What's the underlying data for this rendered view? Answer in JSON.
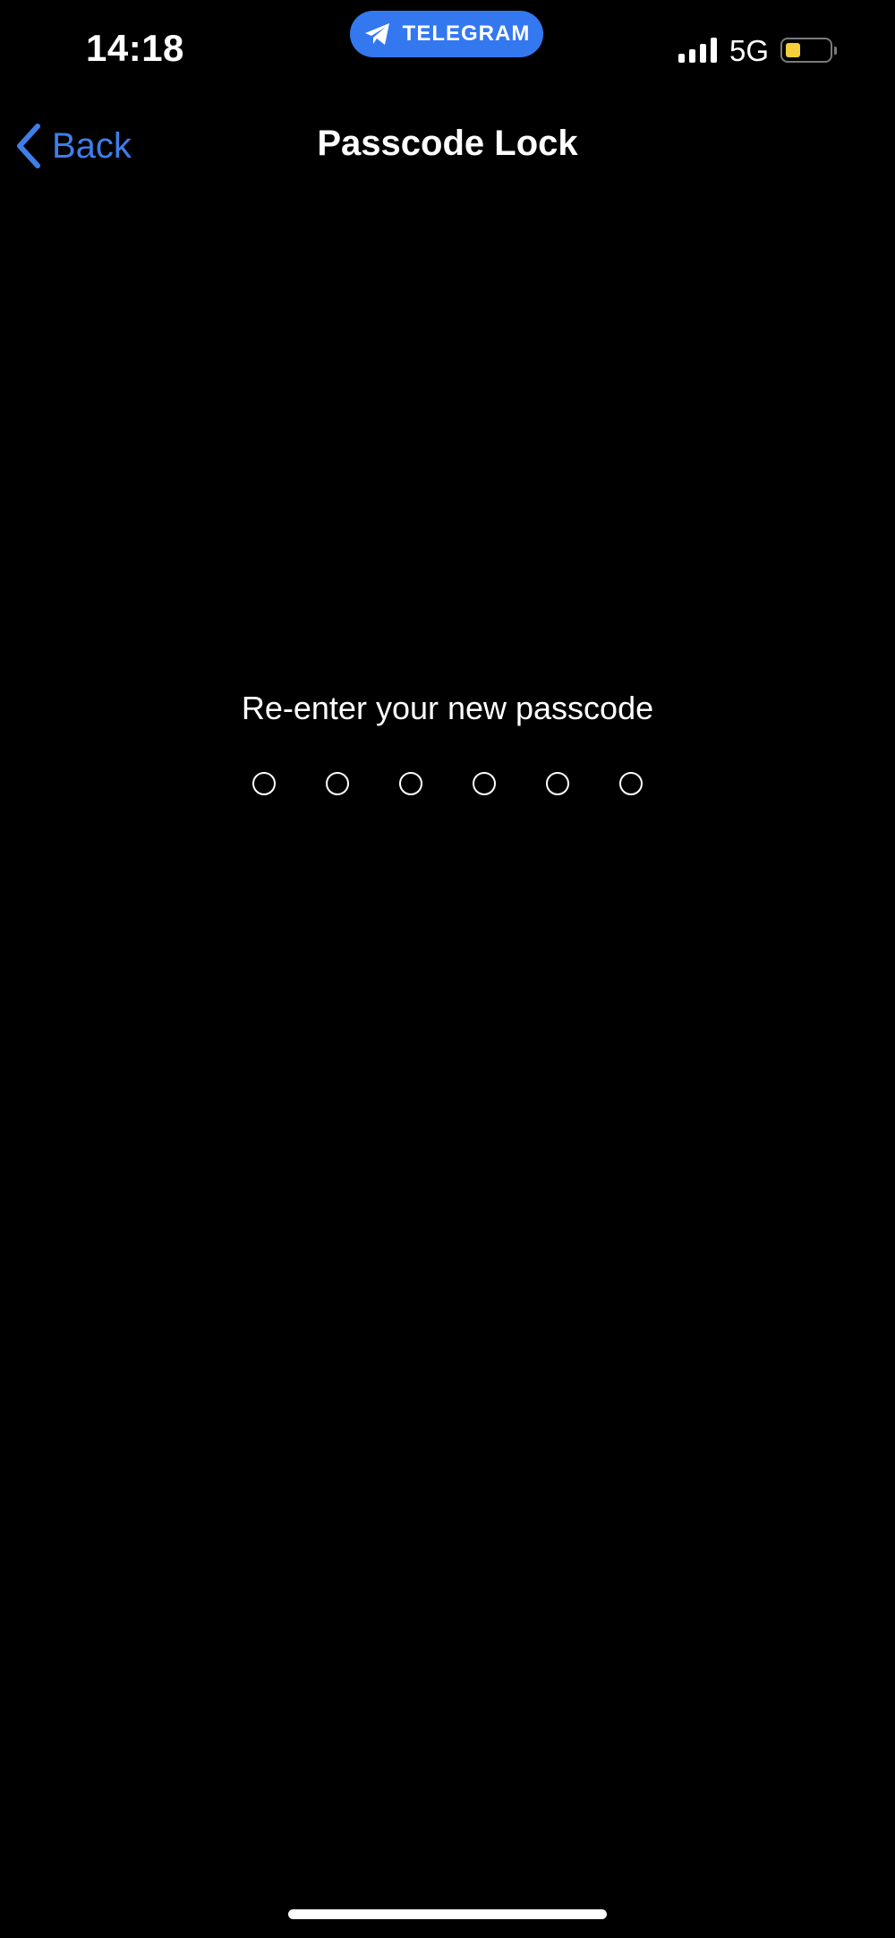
{
  "status_bar": {
    "time": "14:18",
    "app_pill_label": "TELEGRAM",
    "app_pill_icon": "telegram-plane-icon",
    "network": "5G",
    "signal_icon": "cellular-signal-icon",
    "battery_level": 0.35,
    "battery_color": "#f5cf3b"
  },
  "nav": {
    "back_label": "Back",
    "back_icon": "chevron-left-icon",
    "title": "Passcode Lock"
  },
  "passcode": {
    "prompt": "Re-enter your new passcode",
    "digits_total": 6,
    "digits_entered": 0
  },
  "colors": {
    "background": "#000000",
    "accent": "#3f7ee8",
    "pill": "#3478f0"
  }
}
